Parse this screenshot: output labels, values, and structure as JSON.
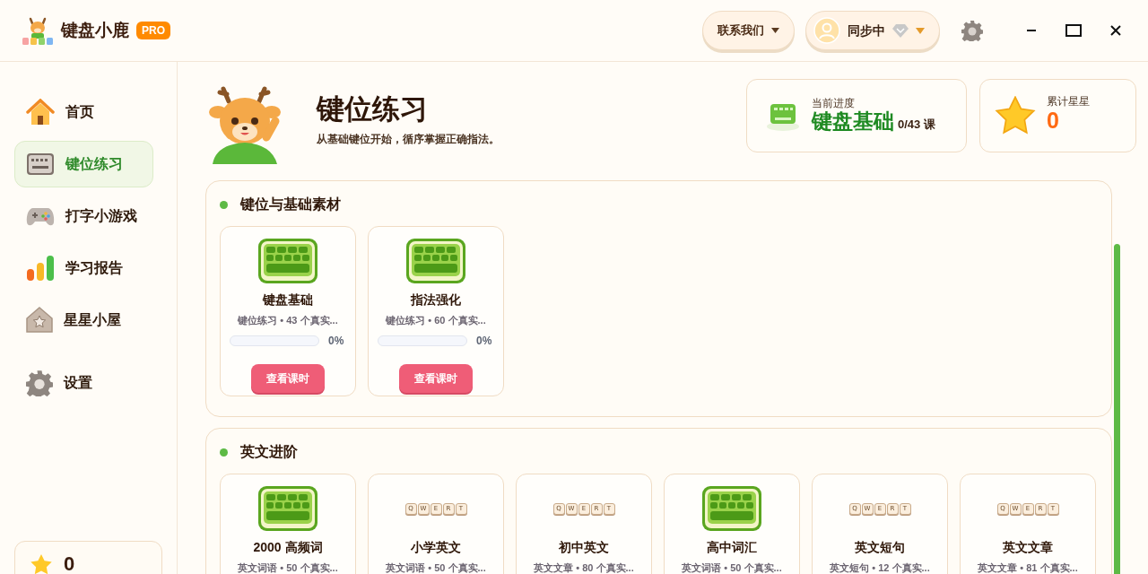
{
  "app": {
    "title": "键盘小鹿",
    "badge": "PRO"
  },
  "header": {
    "contact": "联系我们",
    "sync": "同步中"
  },
  "sidebar": {
    "items": [
      {
        "label": "首页",
        "selected": false
      },
      {
        "label": "键位练习",
        "selected": true
      },
      {
        "label": "打字小游戏",
        "selected": false
      },
      {
        "label": "学习报告",
        "selected": false
      },
      {
        "label": "星星小屋",
        "selected": false
      },
      {
        "label": "设置",
        "selected": false
      }
    ],
    "stars": "0"
  },
  "hero": {
    "title": "键位练习",
    "subtitle": "从基础键位开始，循序掌握正确指法。"
  },
  "progress": {
    "label": "当前进度",
    "course": "键盘基础",
    "count": "0/43 课"
  },
  "stars": {
    "label": "累计星星",
    "value": "0"
  },
  "sections": [
    {
      "title": "键位与基础素材",
      "cards": [
        {
          "kind": "keyboard",
          "title": "键盘基础",
          "meta": "键位练习 • 43 个真实...",
          "level": 0,
          "percent": "0%",
          "button": "查看课时"
        },
        {
          "kind": "keyboard",
          "title": "指法强化",
          "meta": "键位练习 • 60 个真实...",
          "level": 0,
          "percent": "0%",
          "button": "查看课时"
        }
      ]
    },
    {
      "title": "英文进阶",
      "cards": [
        {
          "kind": "keyboard",
          "title": "2000 高频词",
          "meta": "英文词语 • 50 个真实..."
        },
        {
          "kind": "keycaps",
          "keys": [
            "Q",
            "W",
            "E",
            "R",
            "T"
          ],
          "title": "小学英文",
          "meta": "英文词语 • 50 个真实..."
        },
        {
          "kind": "keycaps",
          "keys": [
            "Q",
            "W",
            "E",
            "R",
            "T"
          ],
          "title": "初中英文",
          "meta": "英文文章 • 80 个真实..."
        },
        {
          "kind": "keyboard",
          "title": "高中词汇",
          "meta": "英文词语 • 50 个真实..."
        },
        {
          "kind": "keycaps",
          "keys": [
            "Q",
            "W",
            "E",
            "R",
            "T"
          ],
          "title": "英文短句",
          "meta": "英文短句 • 12 个真实..."
        },
        {
          "kind": "keycaps",
          "keys": [
            "Q",
            "W",
            "E",
            "R",
            "T"
          ],
          "title": "英文文章",
          "meta": "英文文章 • 81 个真实..."
        }
      ]
    }
  ]
}
